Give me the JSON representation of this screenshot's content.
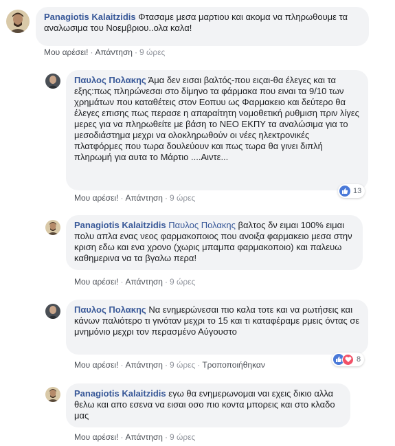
{
  "comments": [
    {
      "author": "Panagiotis Kalaitzidis",
      "mention": "",
      "text": "Φτασαμε μεσα μαρτιου και ακομα να πληρωθουμε τα αναλωσιμα του Νοεμβριου..ολα καλα!",
      "like_label": "Μου αρέσει!",
      "reply_label": "Απάντηση",
      "time": "9 ώρες",
      "edited": ""
    },
    {
      "author": "Παυλος Πολακης",
      "mention": "",
      "text": "Άμα δεν εισαι βαλτός-που ειςαι-θα έλεγες και τα εξης:πως πληρώνεσαι στο δίμηνο τα φάρμακα που ειναι τα 9/10 των χρημάτων που καταθέτεις στον Εοπυυ ως Φαρμακειο και δεύτερο θα έλεγες επισης πως περασε η απαραίτητη νομοθετική ρυθμιση πριν λίγες μερες για να πληρωθείτε με βάση το ΝΕΟ ΕΚΠΥ τα αναλώσιμα για το μεσοδιάστημα μεχρι να ολοκληρωθούν οι νέες ηλεκτρονικές πλατφόρμες που τωρα δουλεύουν και πως τωρα θα γινει διπλή πληρωμή για αυτα το Μάρτιο ....Αιντε...",
      "like_label": "Μου αρέσει!",
      "reply_label": "Απάντηση",
      "time": "9 ώρες",
      "edited": "",
      "reactions": {
        "count": "13",
        "icons": [
          "like-icon"
        ]
      }
    },
    {
      "author": "Panagiotis Kalaitzidis",
      "mention": "Παυλος Πολακης",
      "text": "βαλτος δν ειμαι 100% ειμαι πολυ απλα ενας νεος φαρμακοποιος που ανοιξα φαρμακειο μεσα στην κριση εδω και ενα χρονο (χωρις μπαμπα φαρμακοποιο) και παλευω καθημερινα να τα βγαλω περα!",
      "like_label": "Μου αρέσει!",
      "reply_label": "Απάντηση",
      "time": "9 ώρες",
      "edited": ""
    },
    {
      "author": "Παυλος Πολακης",
      "mention": "",
      "text": "Να ενημερώνεσαι πιο καλα τοτε και να ρωτήσεις και κάνων παλιότερο τι γινόταν μεχρι το 15 και τι καταφέραμε ρμεις όντας σε μνημόνιο μεχρι τον περασμένο Αύγουστο",
      "like_label": "Μου αρέσει!",
      "reply_label": "Απάντηση",
      "time": "9 ώρες",
      "edited": "Τροποποιήθηκαν",
      "reactions": {
        "count": "8",
        "icons": [
          "like-icon",
          "love-icon"
        ]
      }
    },
    {
      "author": "Panagiotis Kalaitzidis",
      "mention": "",
      "text": "εγω θα ενημερωνομαι ναι εχεις δικιο αλλα θελω και απο εσενα να εισαι οσο πιο κοντα μπορεις και στο κλαδο μας",
      "like_label": "Μου αρέσει!",
      "reply_label": "Απάντηση",
      "time": "9 ώρες",
      "edited": ""
    }
  ],
  "colors": {
    "author": "#385898",
    "bubble": "#f2f3f5",
    "meta": "#90949c",
    "like": "#4a79d8",
    "love": "#f25268"
  }
}
